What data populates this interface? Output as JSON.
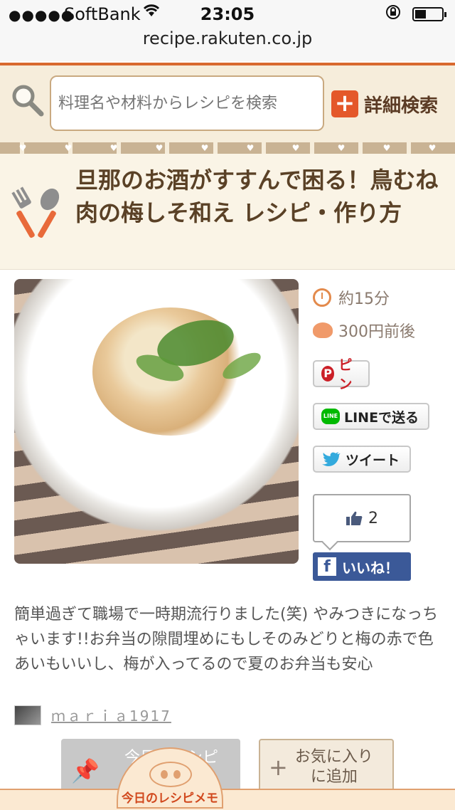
{
  "status_bar": {
    "signal": "●●●●●",
    "carrier": "SoftBank",
    "time": "23:05"
  },
  "browser": {
    "url": "recipe.rakuten.co.jp"
  },
  "search": {
    "placeholder": "料理名や材料からレシピを検索",
    "advanced_label": "詳細検索"
  },
  "recipe": {
    "title": "旦那のお酒がすすんで困る！鳥むね肉の梅しそ和え レシピ・作り方",
    "time": "約15分",
    "cost": "300円前後",
    "description": "簡単過ぎて職場で一時期流行りました(笑) やみつきになっちゃいます!!お弁当の隙間埋めにもしそのみどりと梅の赤で色あいもいいし、梅が入ってるので夏のお弁当も安心",
    "author": "ｍａｒｉａ1917"
  },
  "share": {
    "pin_label": "ピン",
    "line_label": "LINEで送る",
    "line_icon_text": "LINE",
    "tweet_label": "ツイート",
    "like_count": "2",
    "facebook_like_label": "いいね！"
  },
  "bottom": {
    "memo_button_label": "今日のレシピ\nに追加する",
    "fav_button_label_1": "お気に入り",
    "fav_button_label_2": "に追加",
    "memo_tab_label": "今日のレシピメモ"
  },
  "colors": {
    "accent_orange": "#d9692f",
    "brand_brown": "#5a4126",
    "facebook_blue": "#3b5998",
    "line_green": "#00b900",
    "pinterest_red": "#cb1f27"
  }
}
